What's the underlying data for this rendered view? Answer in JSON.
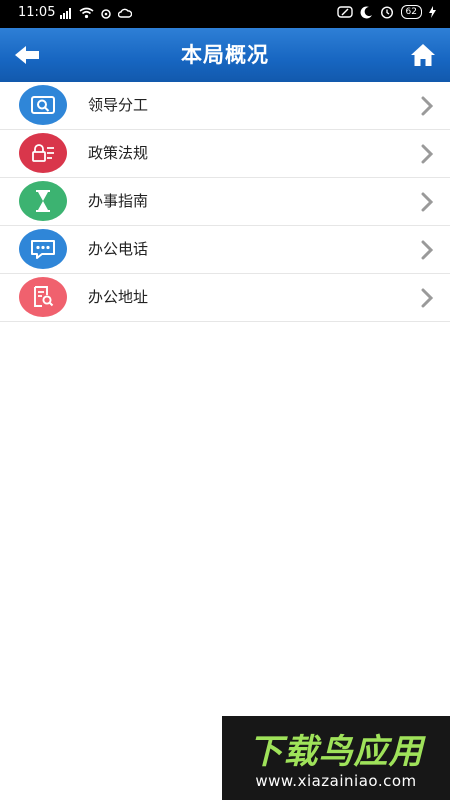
{
  "status_bar": {
    "time": "11:05",
    "battery": "62"
  },
  "header": {
    "title": "本局概况",
    "back_icon": "arrow-left-icon",
    "home_icon": "home-icon"
  },
  "menu": [
    {
      "label": "领导分工",
      "icon": "search-card-icon",
      "color": "#2f86d8"
    },
    {
      "label": "政策法规",
      "icon": "lock-doc-icon",
      "color": "#d9364b"
    },
    {
      "label": "办事指南",
      "icon": "hourglass-icon",
      "color": "#3cb371"
    },
    {
      "label": "办公电话",
      "icon": "chat-bubble-icon",
      "color": "#2f86d8"
    },
    {
      "label": "办公地址",
      "icon": "doc-search-icon",
      "color": "#f0616e"
    }
  ],
  "colors": {
    "header": "#1766c1",
    "chevron": "#9a9a9a",
    "divider": "#e6e6e6"
  },
  "watermark": {
    "brand": "下载鸟应用",
    "url": "www.xiazainiao.com"
  }
}
